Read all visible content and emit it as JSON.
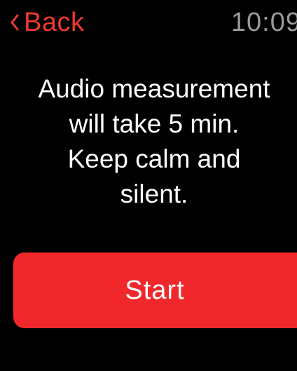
{
  "status_bar": {
    "back_label": "Back",
    "back_icon": "chevron-left-icon",
    "time": "10:09"
  },
  "main": {
    "message_lines": [
      "Audio measurement",
      "will take 5 min.",
      "Keep calm and",
      "silent."
    ],
    "start_label": "Start"
  },
  "colors": {
    "background": "#000000",
    "accent_red": "#f0282b",
    "back_text": "#f0392f",
    "time_text": "#9a9a9a",
    "message_text": "#ffffff"
  }
}
